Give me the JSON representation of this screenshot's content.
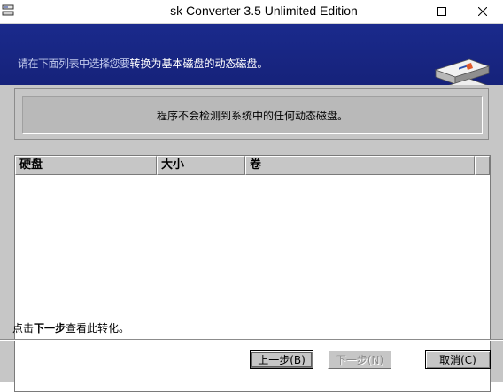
{
  "window": {
    "title": "sk Converter 3.5 Unlimited Edition",
    "min_glyph": "—",
    "max_glyph": "☐",
    "close_glyph": "✕"
  },
  "banner": {
    "ghost_text": "请在下面列表中选择您要",
    "text": "转换为基本磁盘的动态磁盘。"
  },
  "info": {
    "message": "程序不会检测到系统中的任何动态磁盘。"
  },
  "table": {
    "columns": [
      "硬盘",
      "大小",
      "卷",
      ""
    ],
    "rows": []
  },
  "hint": {
    "prefix": "点击",
    "bold": "下一步",
    "suffix": "查看此转化。"
  },
  "buttons": {
    "back": "上一步(B)",
    "next": "下一步(N)",
    "cancel": "取消(C)"
  },
  "colors": {
    "banner": "#1a2a8c",
    "panel": "#c6c6c6"
  }
}
